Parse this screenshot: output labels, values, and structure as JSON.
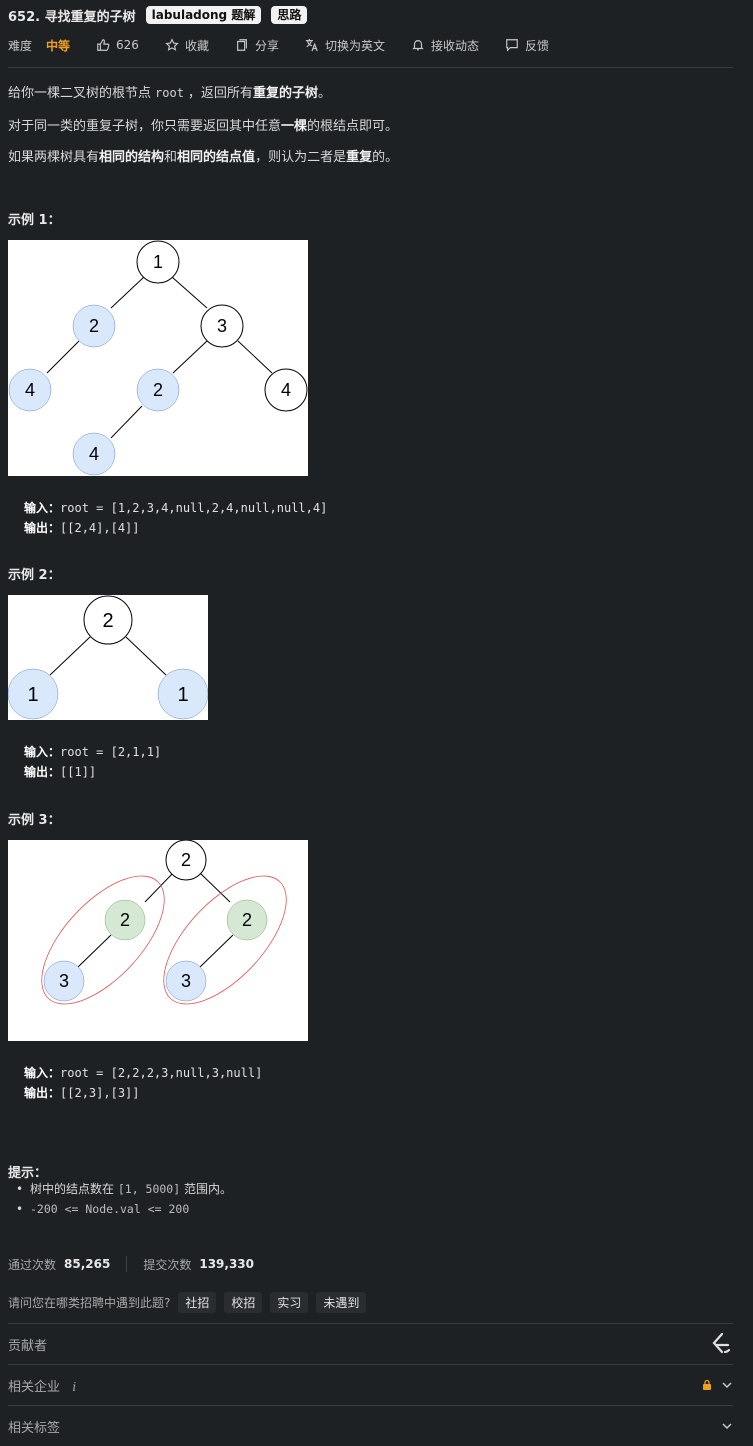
{
  "header": {
    "number": "652.",
    "title": "寻找重复的子树",
    "tags": [
      "labuladong 题解",
      "思路"
    ]
  },
  "meta": {
    "difficulty_label": "难度",
    "difficulty": "中等",
    "likes": "626",
    "favorite": "收藏",
    "share": "分享",
    "switch_lang": "切换为英文",
    "notify": "接收动态",
    "feedback": "反馈"
  },
  "description": {
    "p1_a": "给你一棵二叉树的根节点",
    "p1_code": "root",
    "p1_b": "，返回所有",
    "p1_bold": "重复的子树",
    "p1_c": "。",
    "p2_a": "对于同一类的重复子树，你只需要返回其中任意",
    "p2_bold": "一棵",
    "p2_b": "的根结点即可。",
    "p3_a": "如果两棵树具有",
    "p3_bold1": "相同的结构",
    "p3_b": "和",
    "p3_bold2": "相同的结点值",
    "p3_c": "，则认为二者是",
    "p3_bold3": "重复",
    "p3_d": "的。"
  },
  "examples": [
    {
      "title": "示例 1：",
      "input_label": "输入：",
      "input": "root = [1,2,3,4,null,2,4,null,null,4]",
      "output_label": "输出：",
      "output": "[[2,4],[4]]",
      "nodes": [
        "1",
        "2",
        "3",
        "4",
        "2",
        "4",
        "4"
      ]
    },
    {
      "title": "示例 2：",
      "input_label": "输入：",
      "input": "root = [2,1,1]",
      "output_label": "输出：",
      "output": "[[1]]",
      "nodes": [
        "2",
        "1",
        "1"
      ]
    },
    {
      "title": "示例 3：",
      "input_label": "输入：",
      "input": "root = [2,2,2,3,null,3,null]",
      "output_label": "输出：",
      "output": "[[2,3],[3]]",
      "nodes": [
        "2",
        "2",
        "2",
        "3",
        "3"
      ]
    }
  ],
  "hints": {
    "title": "提示：",
    "h1_a": "树中的结点数在",
    "h1_code": "[1, 5000]",
    "h1_b": "范围内。",
    "h2_code": "-200 <= Node.val <= 200"
  },
  "stats": {
    "accepted_label": "通过次数",
    "accepted": "85,265",
    "submitted_label": "提交次数",
    "submitted": "139,330"
  },
  "survey": {
    "question": "请问您在哪类招聘中遇到此题?",
    "options": [
      "社招",
      "校招",
      "实习",
      "未遇到"
    ]
  },
  "sections": {
    "contributors": "贡献者",
    "companies": "相关企业",
    "companies_info": "i",
    "tags": "相关标签"
  },
  "colors": {
    "background": "#1e2124",
    "difficulty_medium": "#f0a020",
    "node_blue": "#dae8fc",
    "node_green": "#d5e8d4",
    "lock": "#f0a020"
  }
}
